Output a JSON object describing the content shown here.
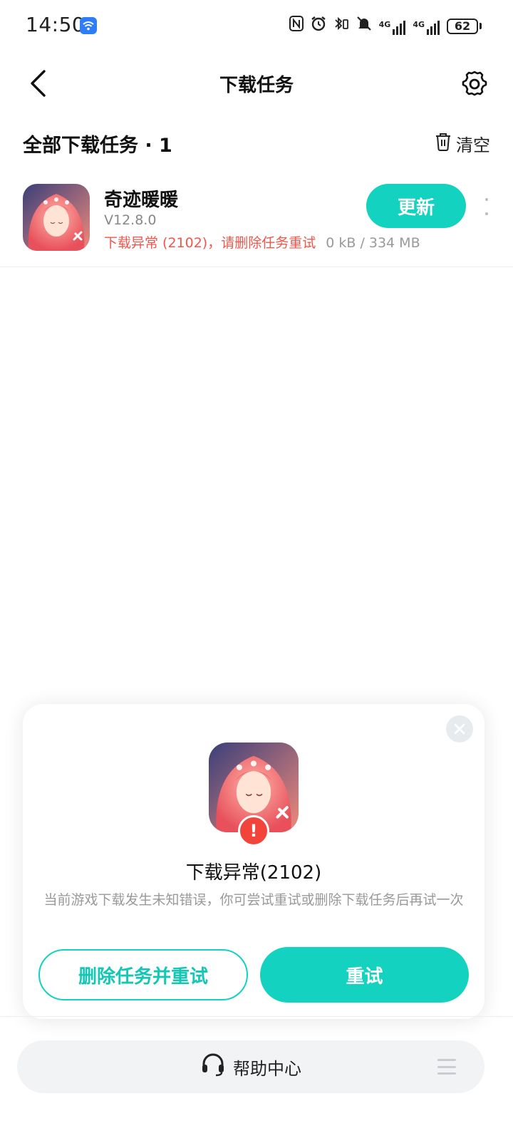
{
  "status_bar": {
    "time": "14:50",
    "network_label": "4G",
    "battery": "62",
    "icons": [
      "wifi-icon",
      "nfc-icon",
      "alarm-icon",
      "bluetooth-icon",
      "mute-icon",
      "signal-icon",
      "battery-icon"
    ]
  },
  "header": {
    "title": "下载任务",
    "back_icon": "back-arrow-icon",
    "settings_icon": "gear-icon"
  },
  "section": {
    "title": "全部下载任务 · 1",
    "clear_label": "清空",
    "clear_icon": "trash-icon"
  },
  "task": {
    "name": "奇迹暖暖",
    "version": "V12.8.0",
    "status_error": "下载异常 (2102)，请删除任务重试",
    "size_progress": "0 kB / 334 MB",
    "action_label": "更新",
    "more_icon": "more-vertical-icon"
  },
  "dialog": {
    "title": "下载异常(2102)",
    "description": "当前游戏下载发生未知错误，你可尝试重试或删除下载任务后再试一次",
    "delete_retry_label": "删除任务并重试",
    "retry_label": "重试",
    "close_icon": "close-icon",
    "warning_icon": "exclamation-icon"
  },
  "help": {
    "label": "帮助中心",
    "icon": "headset-icon",
    "menu_icon": "menu-icon"
  },
  "colors": {
    "accent": "#13d2bf",
    "error": "#f2554b",
    "muted_text": "#999999"
  }
}
